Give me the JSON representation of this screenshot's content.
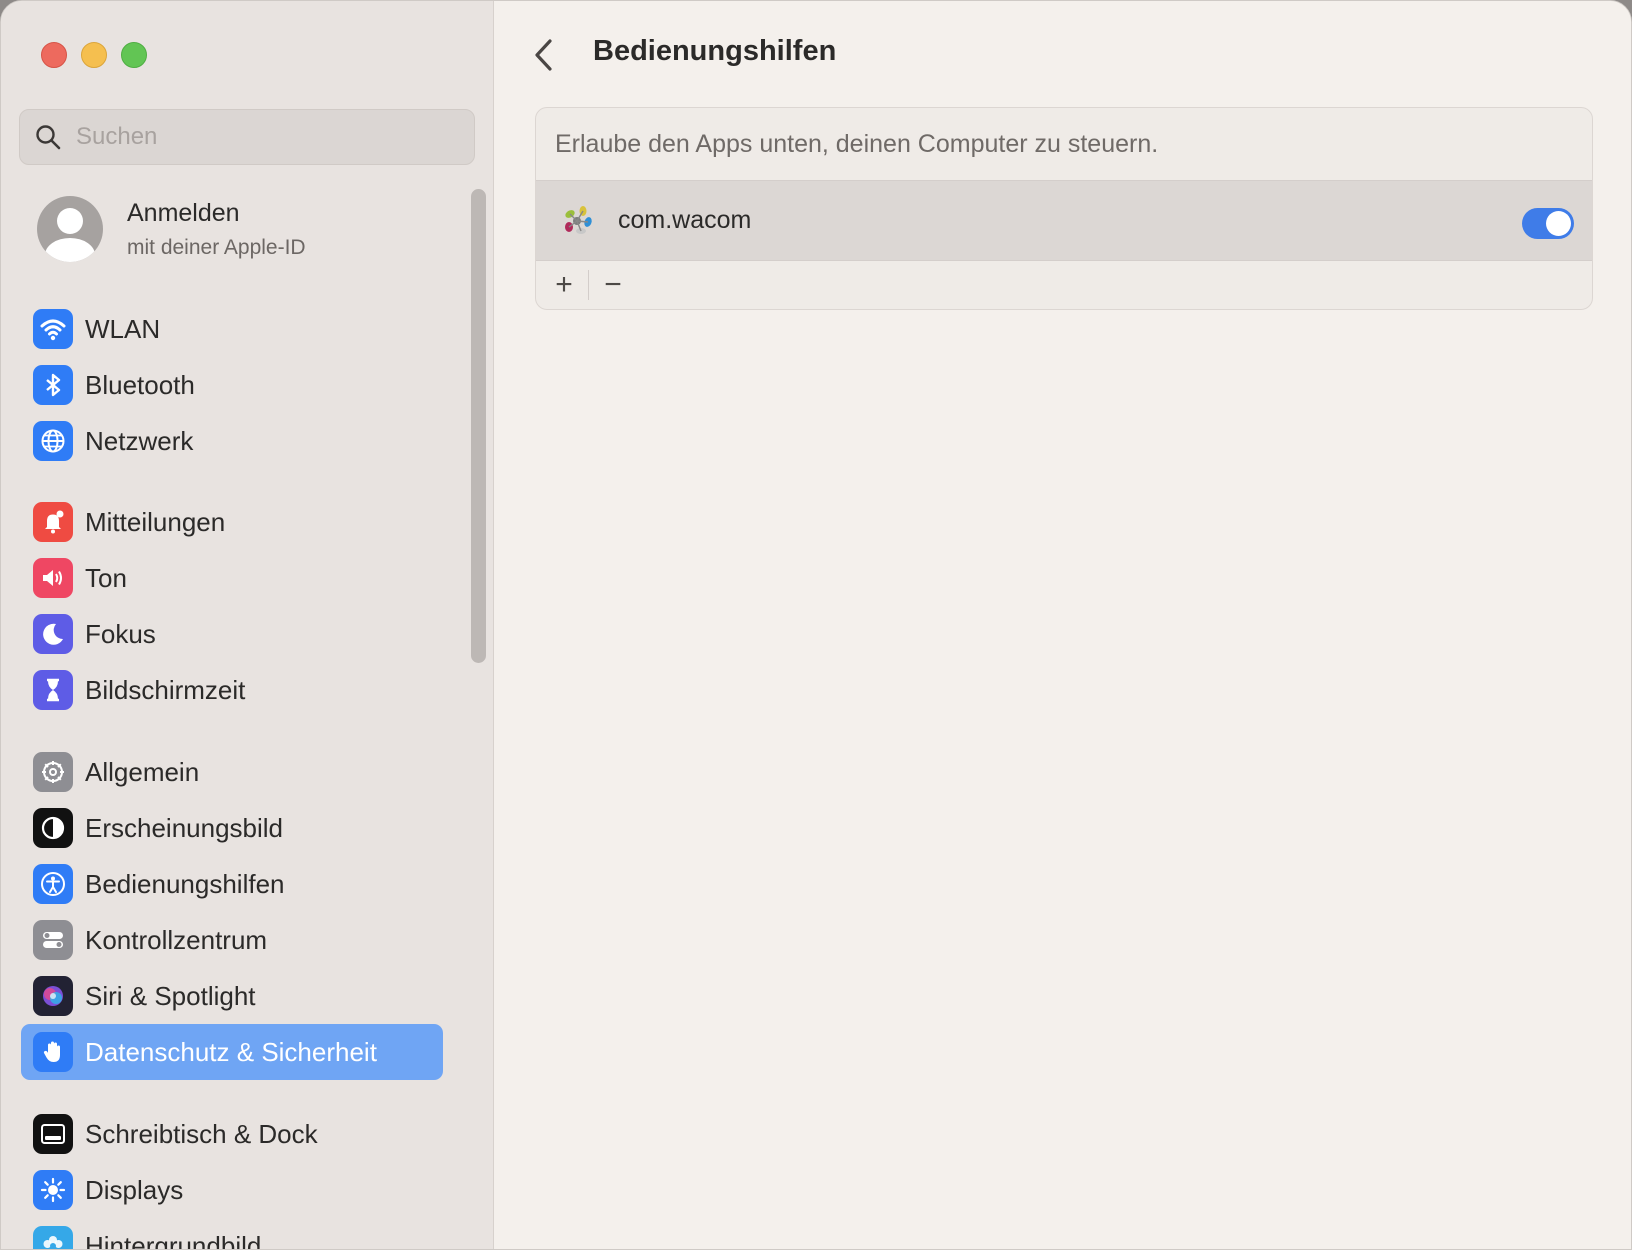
{
  "window": {
    "traffic_lights": [
      "close",
      "minimize",
      "zoom"
    ]
  },
  "sidebar": {
    "search": {
      "placeholder": "Suchen",
      "value": ""
    },
    "account": {
      "name": "Anmelden",
      "subtitle": "mit deiner Apple-ID"
    },
    "items": [
      {
        "label": "WLAN",
        "icon": "wifi-icon",
        "color": "#2f7cf6"
      },
      {
        "label": "Bluetooth",
        "icon": "bluetooth-icon",
        "color": "#2f7cf6"
      },
      {
        "label": "Netzwerk",
        "icon": "globe-icon",
        "color": "#2f7cf6"
      },
      {
        "label": "Mitteilungen",
        "icon": "bell-icon",
        "color": "#ef4b42"
      },
      {
        "label": "Ton",
        "icon": "speaker-icon",
        "color": "#ef4763"
      },
      {
        "label": "Fokus",
        "icon": "moon-icon",
        "color": "#5e5ce6"
      },
      {
        "label": "Bildschirmzeit",
        "icon": "hourglass-icon",
        "color": "#5e5ce6"
      },
      {
        "label": "Allgemein",
        "icon": "gear-icon",
        "color": "#8e8e93"
      },
      {
        "label": "Erscheinungsbild",
        "icon": "appearance-icon",
        "color": "#111111"
      },
      {
        "label": "Bedienungshilfen",
        "icon": "accessibility-icon",
        "color": "#2f7cf6"
      },
      {
        "label": "Kontrollzentrum",
        "icon": "toggles-icon",
        "color": "#8e8e93"
      },
      {
        "label": "Siri & Spotlight",
        "icon": "siri-icon",
        "color": "#222233"
      },
      {
        "label": "Datenschutz & Sicherheit",
        "icon": "hand-icon",
        "color": "#2f7cf6",
        "selected": true
      },
      {
        "label": "Schreibtisch & Dock",
        "icon": "dock-icon",
        "color": "#111111"
      },
      {
        "label": "Displays",
        "icon": "sun-icon",
        "color": "#2f7cf6"
      },
      {
        "label": "Hintergrundbild",
        "icon": "flower-icon",
        "color": "#35a8e8"
      }
    ]
  },
  "main": {
    "title": "Bedienungshilfen",
    "description": "Erlaube den Apps unten, deinen Computer zu steuern.",
    "apps": [
      {
        "name": "com.wacom",
        "enabled": true,
        "icon": "wacom-icon"
      }
    ],
    "add_label": "+",
    "remove_label": "−"
  }
}
